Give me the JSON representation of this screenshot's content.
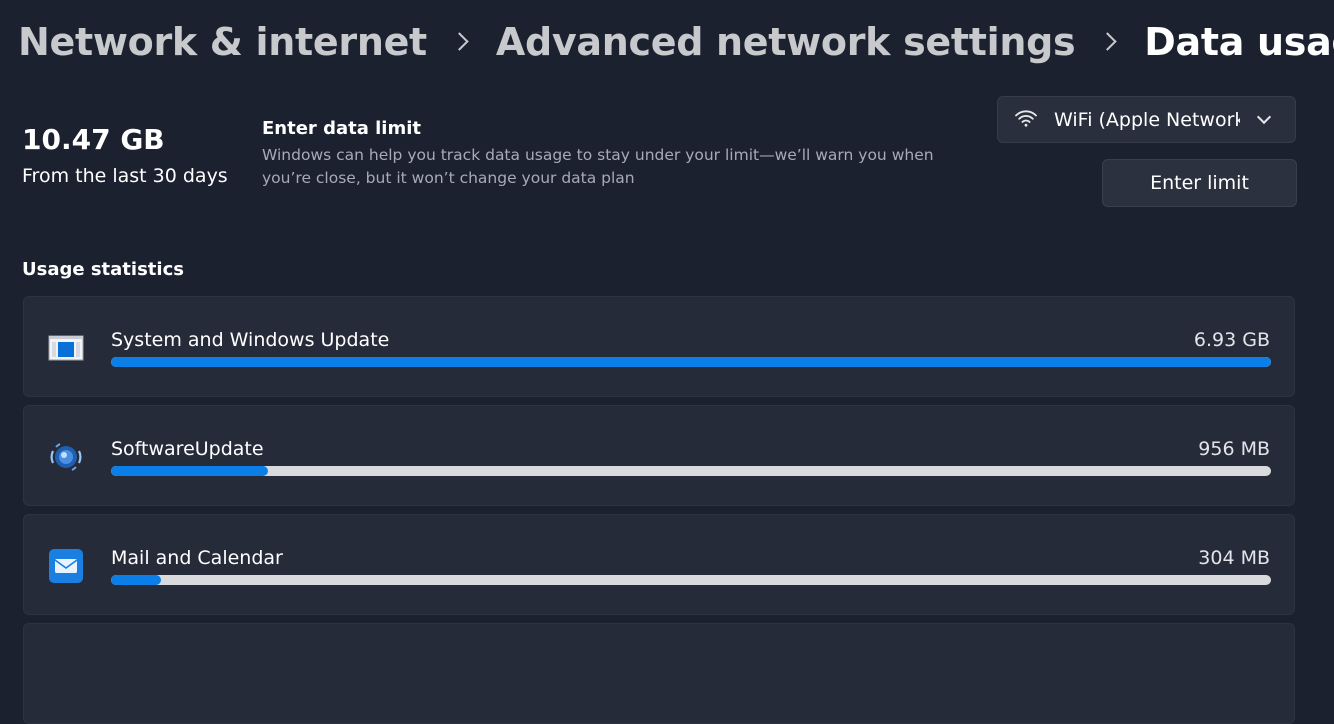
{
  "breadcrumb": {
    "items": [
      "Network & internet",
      "Advanced network settings"
    ],
    "current": "Data usage"
  },
  "summary": {
    "total": "10.47 GB",
    "caption": "From the last 30 days"
  },
  "data_limit": {
    "title": "Enter data limit",
    "description": "Windows can help you track data usage to stay under your limit—we’ll warn you when you’re close, but it won’t change your data plan",
    "button_label": "Enter limit"
  },
  "network_selector": {
    "icon": "wifi-icon",
    "value": "WiFi (Apple Network"
  },
  "usage_statistics": {
    "title": "Usage statistics",
    "items": [
      {
        "name": "System and Windows Update",
        "size": "6.93 GB",
        "fraction": 1.0,
        "icon": "system-update-icon"
      },
      {
        "name": "SoftwareUpdate",
        "size": "956 MB",
        "fraction": 0.135,
        "icon": "software-update-icon"
      },
      {
        "name": "Mail and Calendar",
        "size": "304 MB",
        "fraction": 0.043,
        "icon": "mail-icon"
      }
    ]
  },
  "colors": {
    "background": "#1c2130",
    "card": "#262b3a",
    "accent": "#0b7ee8",
    "bar_track": "#d9dade"
  }
}
